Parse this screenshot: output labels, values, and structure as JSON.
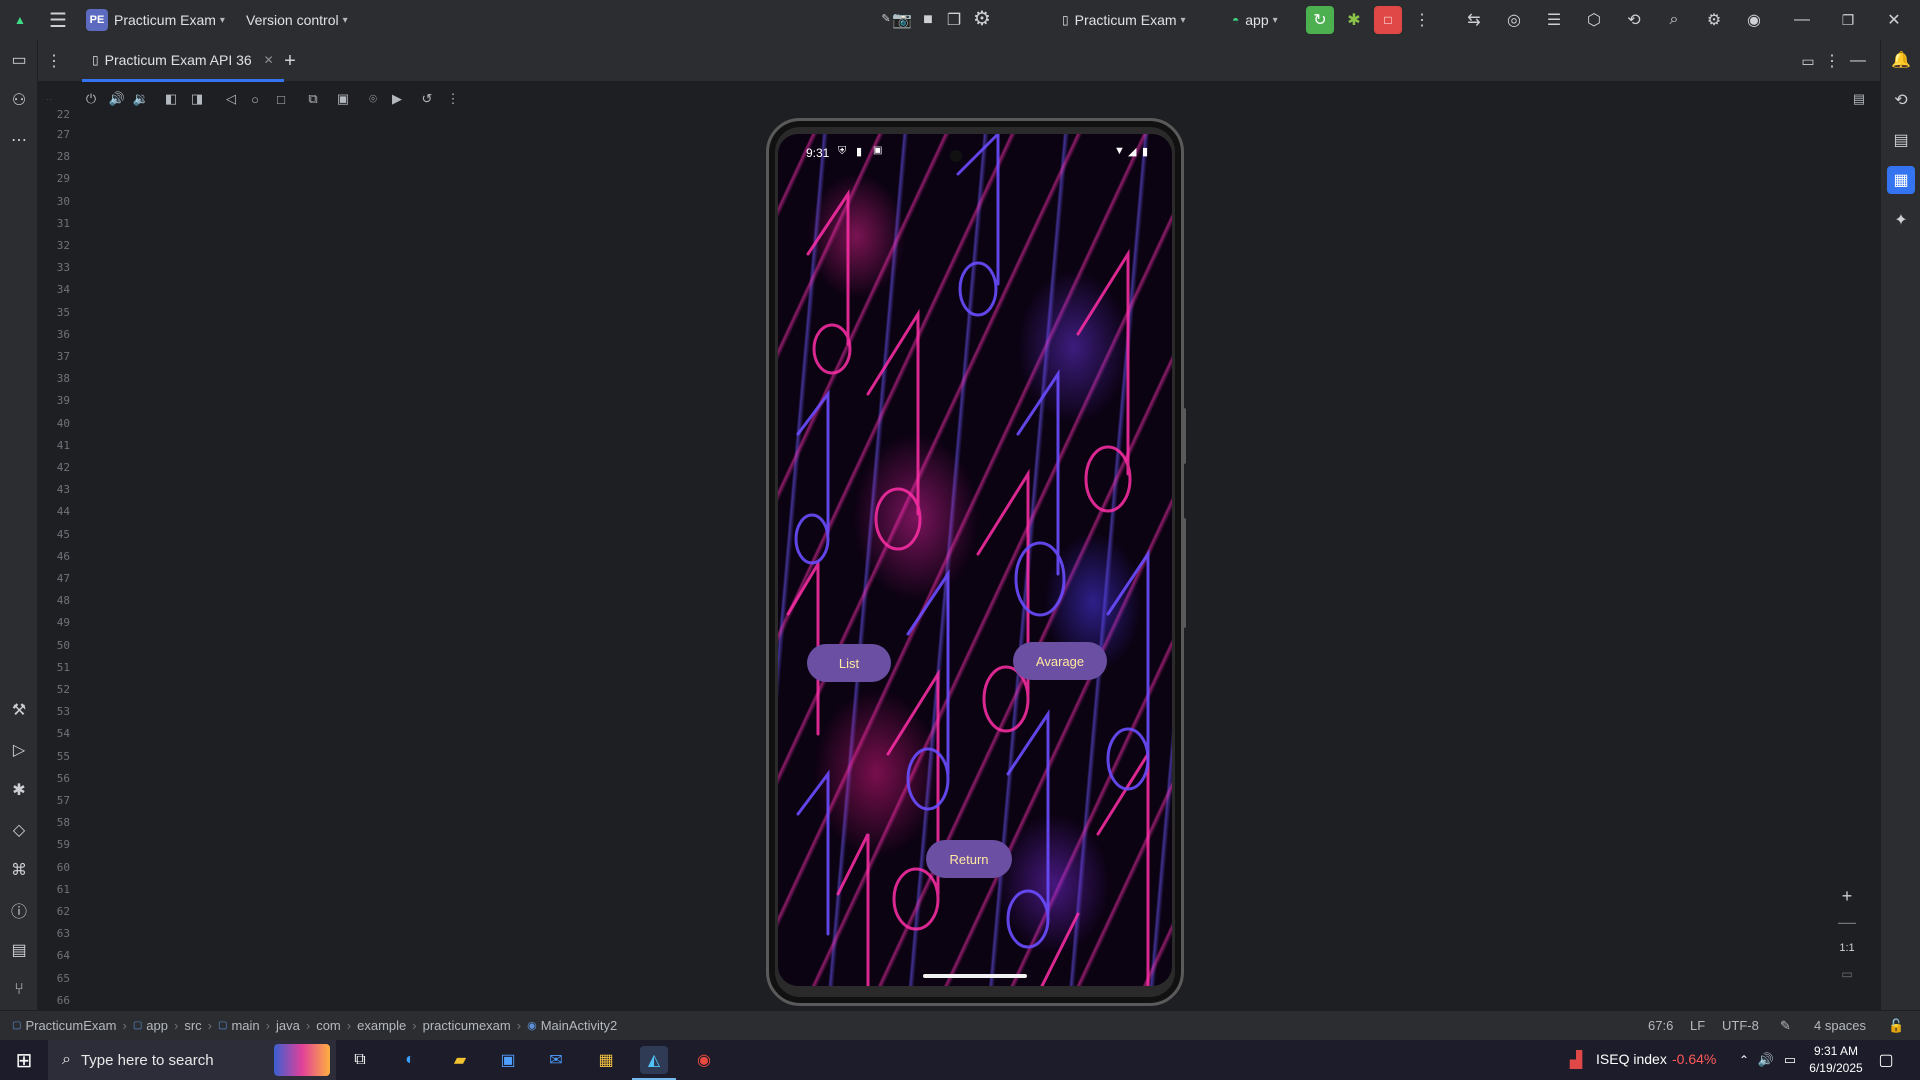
{
  "titlebar": {
    "project_badge": "PE",
    "project_name": "Practicum Exam",
    "version_control": "Version control",
    "run_config": "Practicum Exam",
    "module": "app"
  },
  "tabs": [
    {
      "label": "Practicum Exam API 36",
      "active": true
    }
  ],
  "gutter_lines": [
    "22",
    "27",
    "28",
    "29",
    "30",
    "31",
    "32",
    "33",
    "34",
    "35",
    "36",
    "37",
    "38",
    "39",
    "40",
    "41",
    "42",
    "43",
    "44",
    "45",
    "46",
    "47",
    "48",
    "49",
    "50",
    "51",
    "52",
    "53",
    "54",
    "55",
    "56",
    "57",
    "58",
    "59",
    "60",
    "61",
    "62",
    "63",
    "64",
    "65",
    "66"
  ],
  "device": {
    "status_time": "9:31",
    "buttons": {
      "list": "List",
      "average": "Avarage",
      "return": "Return"
    }
  },
  "zoom": {
    "one_to_one": "1:1"
  },
  "breadcrumb": [
    "PracticumExam",
    "app",
    "src",
    "main",
    "java",
    "com",
    "example",
    "practicumexam",
    "MainActivity2"
  ],
  "statusbar": {
    "position": "67:6",
    "line_ending": "LF",
    "encoding": "UTF-8",
    "indent": "4 spaces"
  },
  "taskbar": {
    "search_placeholder": "Type here to search",
    "stock_name": "ISEQ index",
    "stock_change": "-0.64%",
    "time": "9:31 AM",
    "date": "6/19/2025"
  },
  "colors": {
    "accent": "#3574f0",
    "app_button": "#6a4fa3",
    "app_button_text": "#ffe8a0",
    "stock_negative": "#ff5a5a",
    "run_green": "#4caf50",
    "stop_red": "#e04848"
  }
}
